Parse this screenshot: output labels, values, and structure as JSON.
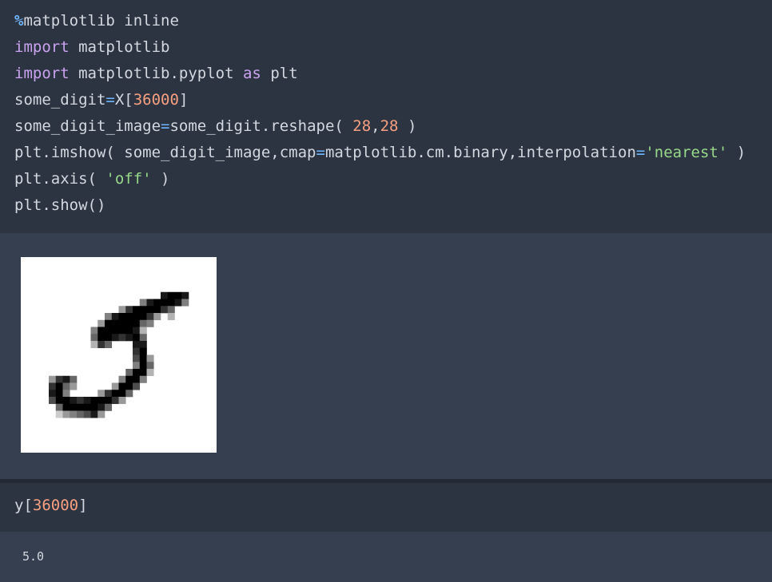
{
  "cell1": {
    "lines": [
      [
        {
          "t": "%",
          "c": "magic"
        },
        {
          "t": "matplotlib inline",
          "c": "plain"
        }
      ],
      [
        {
          "t": "import",
          "c": "kw"
        },
        {
          "t": " matplotlib",
          "c": "plain"
        }
      ],
      [
        {
          "t": "import",
          "c": "kw"
        },
        {
          "t": " matplotlib.pyplot ",
          "c": "plain"
        },
        {
          "t": "as",
          "c": "kw"
        },
        {
          "t": " plt",
          "c": "plain"
        }
      ],
      [
        {
          "t": "some_digit",
          "c": "plain"
        },
        {
          "t": "=",
          "c": "op"
        },
        {
          "t": "X[",
          "c": "plain"
        },
        {
          "t": "36000",
          "c": "num"
        },
        {
          "t": "]",
          "c": "plain"
        }
      ],
      [
        {
          "t": "some_digit_image",
          "c": "plain"
        },
        {
          "t": "=",
          "c": "op"
        },
        {
          "t": "some_digit.reshape( ",
          "c": "plain"
        },
        {
          "t": "28",
          "c": "num"
        },
        {
          "t": ",",
          "c": "plain"
        },
        {
          "t": "28",
          "c": "num"
        },
        {
          "t": " )",
          "c": "plain"
        }
      ],
      [
        {
          "t": "plt.imshow( some_digit_image,cmap",
          "c": "plain"
        },
        {
          "t": "=",
          "c": "op"
        },
        {
          "t": "matplotlib.cm.binary,interpolation",
          "c": "plain"
        },
        {
          "t": "=",
          "c": "op"
        },
        {
          "t": "'nearest'",
          "c": "str"
        },
        {
          "t": " )",
          "c": "plain"
        }
      ],
      [
        {
          "t": "plt.axis( ",
          "c": "plain"
        },
        {
          "t": "'off'",
          "c": "str"
        },
        {
          "t": " )",
          "c": "plain"
        }
      ],
      [
        {
          "t": "plt.show()",
          "c": "plain"
        }
      ]
    ]
  },
  "output1": {
    "image_kind": "handwritten-digit-5-grayscale",
    "grid_rows": [
      "                            ",
      "                            ",
      "                            ",
      "                            ",
      "                            ",
      "                            ",
      "                            ",
      "                            ",
      "                            ",
      "                            ",
      "                            ",
      "                            ",
      "                            ",
      "                            ",
      "                            ",
      "                            ",
      "                            ",
      "                            ",
      "                            ",
      "                            ",
      "                            ",
      "                            ",
      "                            ",
      "                            ",
      "                            ",
      "                            ",
      "                            ",
      "                            "
    ],
    "pixels": [
      [
        5,
        20,
        1.0
      ],
      [
        6,
        20,
        0.95
      ],
      [
        7,
        20,
        0.9
      ],
      [
        8,
        20,
        0.85
      ],
      [
        9,
        20,
        1.0
      ],
      [
        5,
        19,
        0.6
      ],
      [
        6,
        19,
        1.0
      ],
      [
        7,
        19,
        1.0
      ],
      [
        8,
        19,
        1.0
      ],
      [
        9,
        19,
        0.9
      ],
      [
        5,
        18,
        0.3
      ],
      [
        6,
        18,
        0.8
      ],
      [
        7,
        18,
        1.0
      ],
      [
        8,
        18,
        1.0
      ],
      [
        9,
        18,
        0.7
      ],
      [
        6,
        17,
        0.5
      ],
      [
        7,
        17,
        1.0
      ],
      [
        8,
        17,
        1.0
      ],
      [
        9,
        17,
        0.6
      ],
      [
        5,
        16,
        0.3
      ],
      [
        6,
        16,
        0.9
      ],
      [
        7,
        16,
        1.0
      ],
      [
        8,
        16,
        1.0
      ],
      [
        9,
        16,
        1.0
      ],
      [
        10,
        16,
        0.4
      ],
      [
        5,
        15,
        0.2
      ],
      [
        6,
        15,
        0.7
      ],
      [
        7,
        15,
        1.0
      ],
      [
        8,
        15,
        1.0
      ],
      [
        9,
        15,
        1.0
      ],
      [
        10,
        15,
        0.7
      ],
      [
        4,
        14,
        0.3
      ],
      [
        5,
        14,
        1.0
      ],
      [
        6,
        14,
        1.0
      ],
      [
        7,
        14,
        1.0
      ],
      [
        8,
        14,
        1.0
      ],
      [
        9,
        14,
        0.9
      ],
      [
        10,
        14,
        0.3
      ],
      [
        4,
        13,
        0.6
      ],
      [
        5,
        13,
        1.0
      ],
      [
        6,
        13,
        1.0
      ],
      [
        7,
        13,
        0.9
      ],
      [
        4,
        12,
        0.8
      ],
      [
        5,
        12,
        1.0
      ],
      [
        6,
        12,
        1.0
      ],
      [
        7,
        12,
        0.6
      ],
      [
        4,
        11,
        0.9
      ],
      [
        5,
        11,
        1.0
      ],
      [
        6,
        11,
        1.0
      ],
      [
        7,
        11,
        0.5
      ],
      [
        4,
        10,
        0.6
      ],
      [
        5,
        10,
        1.0
      ],
      [
        6,
        10,
        1.0
      ],
      [
        7,
        10,
        0.5
      ],
      [
        5,
        9,
        0.4
      ],
      [
        6,
        9,
        1.0
      ],
      [
        7,
        9,
        1.0
      ],
      [
        8,
        9,
        0.5
      ]
    ],
    "pixels_note_shape": "digit five stroke"
  },
  "cell2": {
    "lines": [
      [
        {
          "t": "y[",
          "c": "plain"
        },
        {
          "t": "36000",
          "c": "num"
        },
        {
          "t": "]",
          "c": "plain"
        }
      ]
    ]
  },
  "output2": {
    "result": "5.0"
  },
  "colors": {
    "code_bg": "#2d3441",
    "output_bg": "#353f50",
    "keyword": "#c9a3f0",
    "operator": "#6fb6ff",
    "number": "#f6a082",
    "string": "#98d88a",
    "text": "#d3d8e0"
  }
}
